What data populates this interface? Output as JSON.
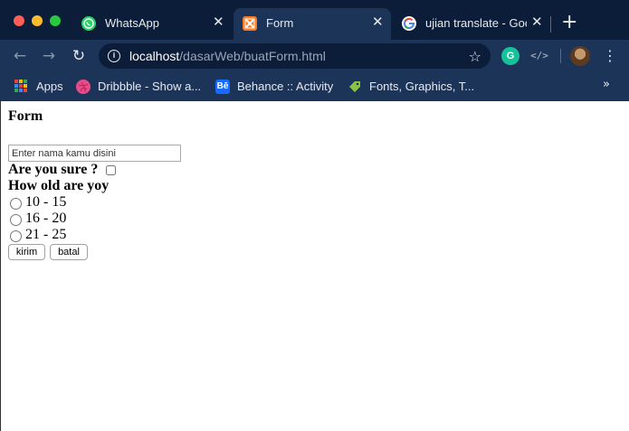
{
  "browser": {
    "tabs": [
      {
        "title": "WhatsApp",
        "icon": "whatsapp-icon",
        "active": false
      },
      {
        "title": "Form",
        "icon": "xampp-icon",
        "active": true
      },
      {
        "title": "ujian translate - Goo",
        "icon": "google-icon",
        "active": false
      }
    ],
    "new_tab_symbol": "+",
    "close_symbol": "✕",
    "address_bar": {
      "host": "localhost",
      "path": "/dasarWeb/buatForm.html"
    },
    "bookmarks": [
      {
        "label": "Apps",
        "icon": "apps-grid-icon"
      },
      {
        "label": "Dribbble - Show a...",
        "icon": "dribbble-icon"
      },
      {
        "label": "Behance :: Activity",
        "icon": "behance-icon"
      },
      {
        "label": "Fonts, Graphics, T...",
        "icon": "tag-icon"
      }
    ],
    "bookmarks_more": "»",
    "extensions": {
      "grammarly": "G",
      "code": "</>"
    },
    "colors": {
      "titlebar": "#0b1d38",
      "toolbar": "#1c3457",
      "active_tab": "#1c3457",
      "whatsapp": "#25d366",
      "xampp": "#fb7a24",
      "dribbble": "#ea4c89",
      "behance": "#1769ff",
      "grammarly": "#15c39a"
    }
  },
  "page": {
    "heading": "Form",
    "name_input": {
      "placeholder": "Enter nama kamu disini",
      "value": ""
    },
    "confirm_question": "Are you sure ?",
    "confirm_checked": false,
    "age_question": "How old are yoy",
    "age_options": [
      "10 - 15",
      "16 - 20",
      "21 - 25"
    ],
    "submit_label": "kirim",
    "cancel_label": "batal"
  }
}
